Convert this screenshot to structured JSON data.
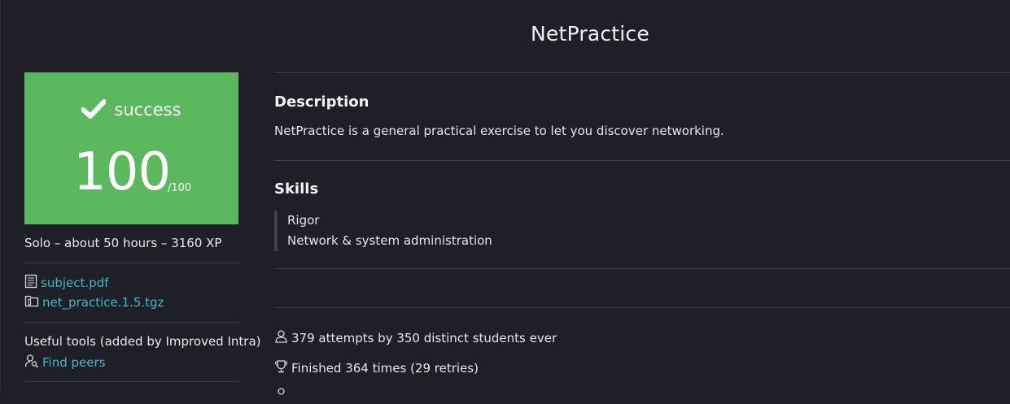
{
  "project": {
    "title": "NetPractice"
  },
  "score": {
    "status": "success",
    "value": "100",
    "max": "/100"
  },
  "meta": {
    "summary": "Solo – about 50 hours – 3160 XP"
  },
  "files": [
    {
      "name": "subject.pdf",
      "icon": "document-icon"
    },
    {
      "name": "net_practice.1.5.tgz",
      "icon": "archive-icon"
    }
  ],
  "tools": {
    "label": "Useful tools (added by Improved Intra)",
    "find_peers": "Find peers"
  },
  "description": {
    "heading": "Description",
    "text": "NetPractice is a general practical exercise to let you discover networking."
  },
  "skills": {
    "heading": "Skills",
    "items": [
      "Rigor",
      "Network & system administration"
    ]
  },
  "stats": {
    "attempts": "379 attempts by 350 distinct students ever",
    "finished": "Finished 364 times (29 retries)"
  },
  "colors": {
    "success": "#5cb85c",
    "link": "#3fb6c9",
    "background": "#1f2027"
  }
}
